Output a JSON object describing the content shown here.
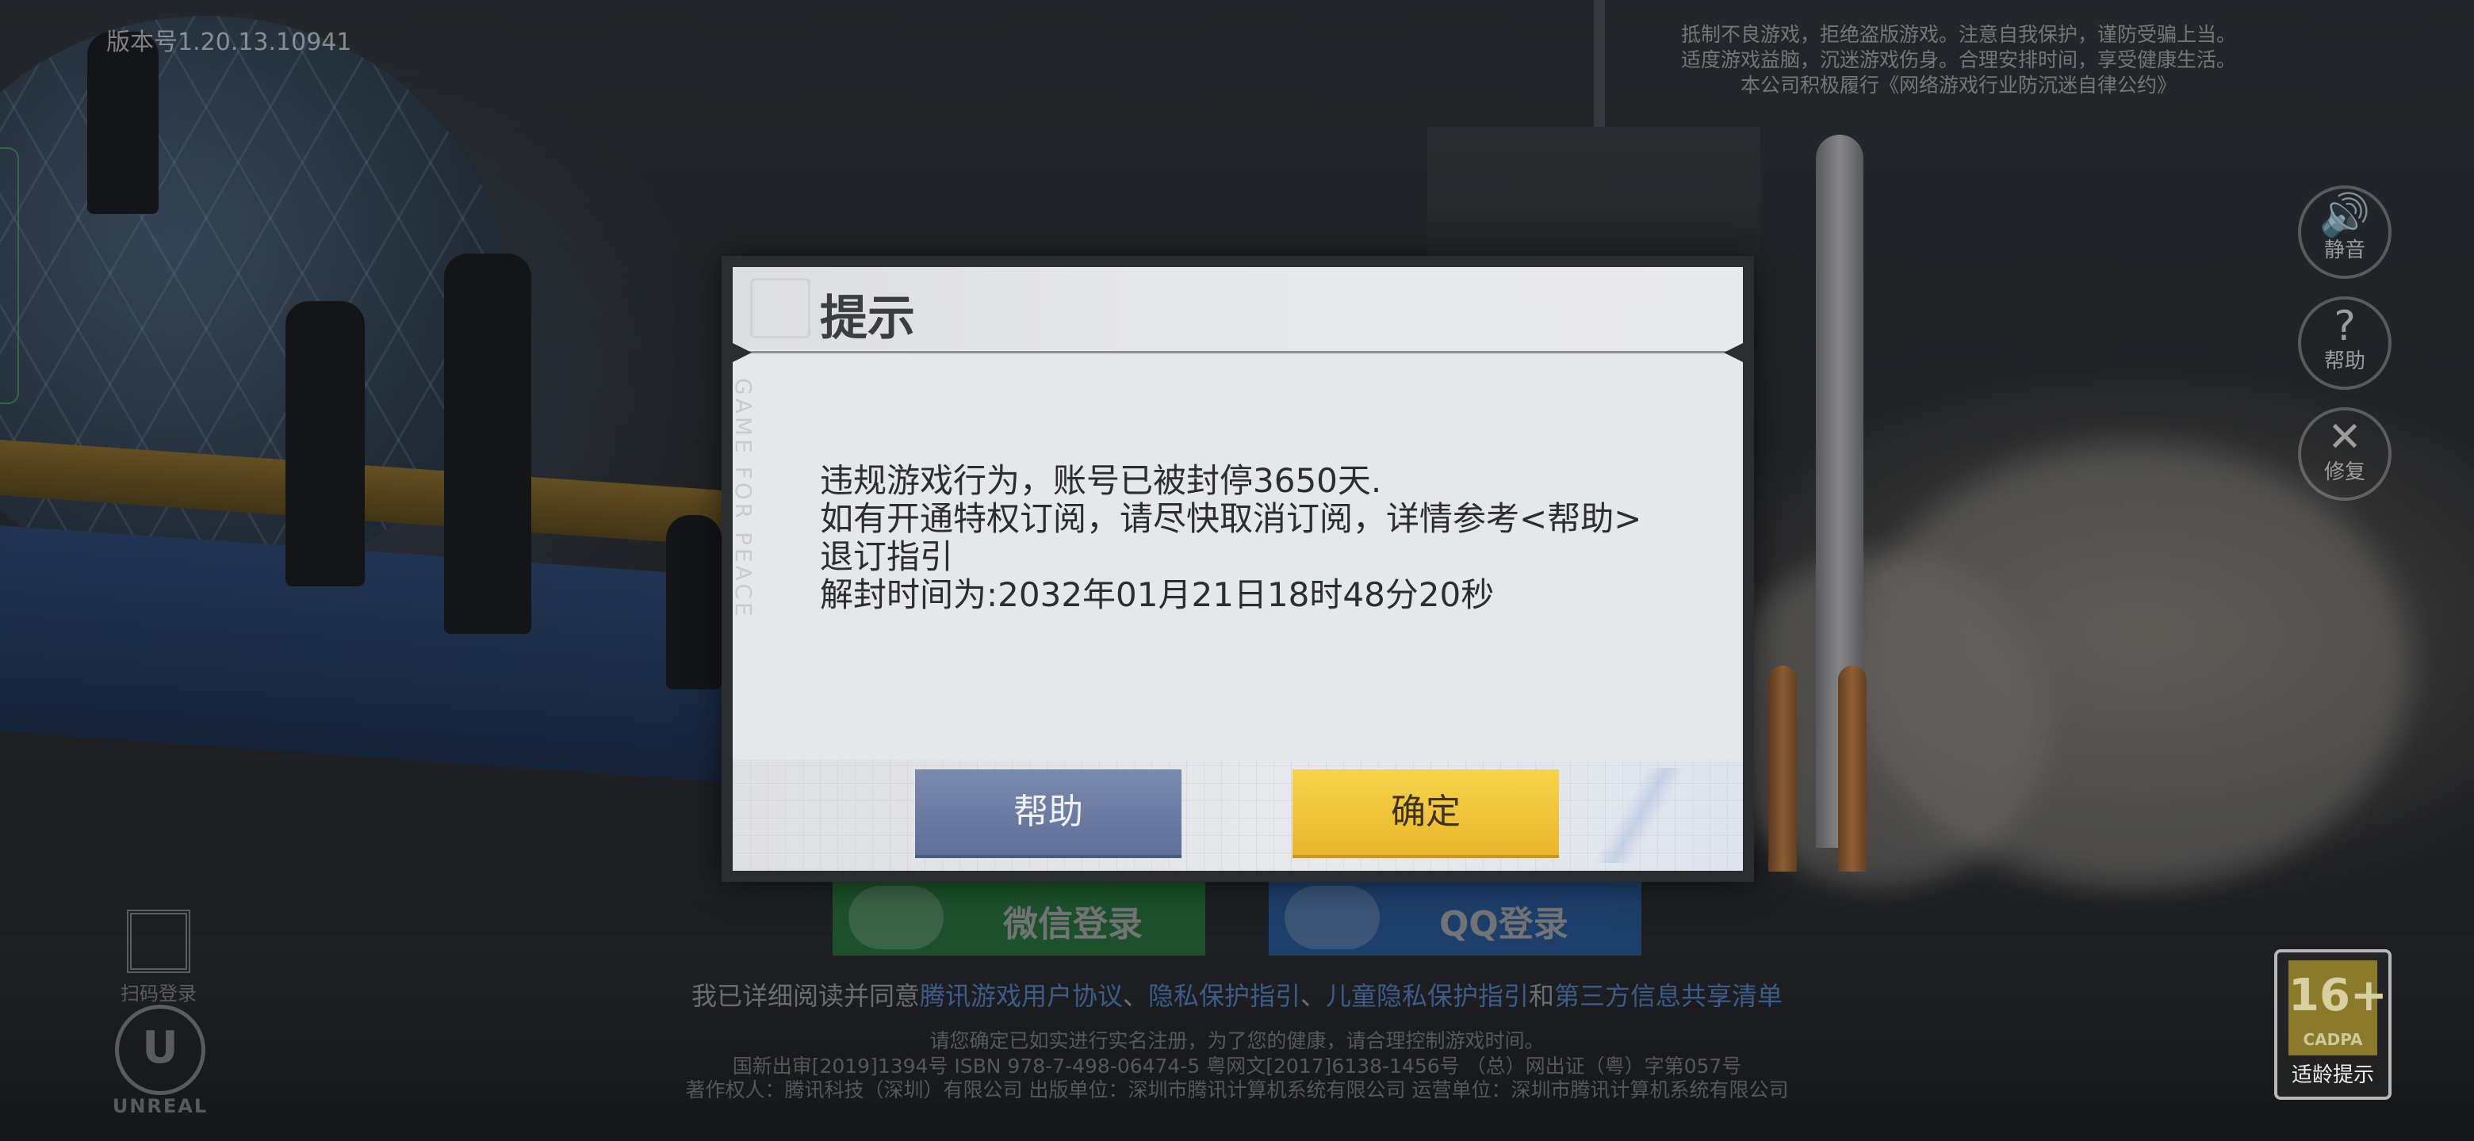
{
  "hud": {
    "version": "版本号1.20.13.10941",
    "notice_lines": [
      "抵制不良游戏，拒绝盗版游戏。注意自我保护，谨防受骗上当。",
      "适度游戏益脑，沉迷游戏伤身。合理安排时间，享受健康生活。",
      "本公司积极履行《网络游戏行业防沉迷自律公约》"
    ]
  },
  "side_buttons": [
    {
      "icon": "speaker-icon",
      "glyph": "🔊",
      "label": "静音"
    },
    {
      "icon": "help-icon",
      "glyph": "?",
      "label": "帮助"
    },
    {
      "icon": "wrench-icon",
      "glyph": "✕",
      "label": "修复"
    }
  ],
  "login": {
    "wechat_label": "微信登录",
    "qq_label": "QQ登录",
    "agreement_prefix": "我已详细阅读并同意",
    "agreement_link1": "腾讯游戏用户协议",
    "agreement_sep1": "、",
    "agreement_link2": "隐私保护指引",
    "agreement_sep2": "、",
    "agreement_link3": "儿童隐私保护指引",
    "agreement_and": "和",
    "agreement_link4": "第三方信息共享清单",
    "realname_hint": "请您确定已如实进行实名注册，为了您的健康，请合理控制游戏时间。",
    "legal_line1": "国新出审[2019]1394号  ISBN 978-7-498-06474-5  粤网文[2017]6138-1456号  （总）网出证（粤）字第057号",
    "legal_line2": "著作权人：腾讯科技（深圳）有限公司  出版单位：深圳市腾讯计算机系统有限公司  运营单位：深圳市腾讯计算机系统有限公司"
  },
  "qr": {
    "label": "扫码登录"
  },
  "engine": {
    "letter": "U",
    "label": "UNREAL"
  },
  "age_rating": {
    "value": "16+",
    "org": "CADPA",
    "label": "适龄提示"
  },
  "modal": {
    "title": "提示",
    "watermark": "GAME FOR PEACE",
    "lines": [
      "违规游戏行为，账号已被封停3650天.",
      "如有开通特权订阅，请尽快取消订阅，详情参考<帮助>",
      "退订指引",
      "解封时间为:2032年01月21日18时48分20秒"
    ],
    "help_button": "帮助",
    "ok_button": "确定"
  }
}
